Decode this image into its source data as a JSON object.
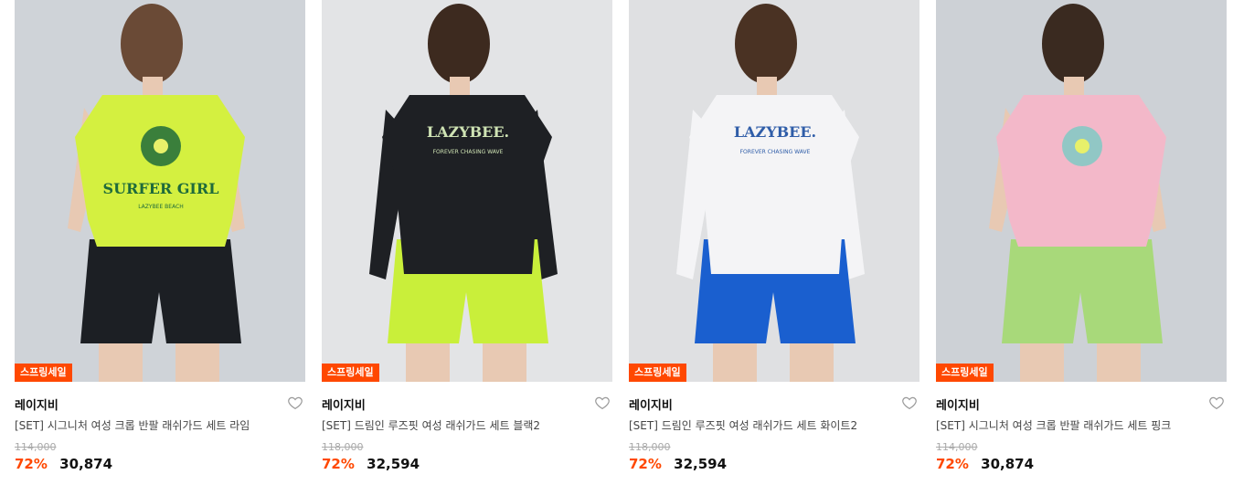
{
  "colors": {
    "accent": "#ff4800",
    "badge_bg": "#ff4800",
    "heart_stroke": "#999999"
  },
  "icons": {
    "wishlist": "heart-outline-icon"
  },
  "products": [
    {
      "badge": "스프링세일",
      "brand": "레이지비",
      "name": "[SET] 시그니처 여성 크롭 반팔 래쉬가드 세트 라임",
      "original_price": "114,000",
      "discount": "72%",
      "price": "30,874",
      "image": {
        "bg": "#cfd3d8",
        "top_color": "#d4f040",
        "bottom_color": "#1c1f24",
        "hair_color": "#6a4a36",
        "print_text": "SURFER GIRL",
        "print_subtext": "LAZYBEE BEACH",
        "print_color": "#1f6b3b",
        "long_sleeve": false
      }
    },
    {
      "badge": "스프링세일",
      "brand": "레이지비",
      "name": "[SET] 드림인 루즈핏 여성 래쉬가드 세트 블랙2",
      "original_price": "118,000",
      "discount": "72%",
      "price": "32,594",
      "image": {
        "bg": "#e3e4e6",
        "top_color": "#1e2024",
        "bottom_color": "#c9ef3a",
        "hair_color": "#3d2a1f",
        "print_text": "LAZYBEE.",
        "print_subtext": "FOREVER CHASING WAVE",
        "print_color": "#cfe3b4",
        "long_sleeve": true
      }
    },
    {
      "badge": "스프링세일",
      "brand": "레이지비",
      "name": "[SET] 드림인 루즈핏 여성 래쉬가드 세트 화이트2",
      "original_price": "118,000",
      "discount": "72%",
      "price": "32,594",
      "image": {
        "bg": "#dfe0e2",
        "top_color": "#f4f4f6",
        "bottom_color": "#1a5fcf",
        "hair_color": "#4a3223",
        "print_text": "LAZYBEE.",
        "print_subtext": "FOREVER CHASING WAVE",
        "print_color": "#2f5da8",
        "long_sleeve": true
      }
    },
    {
      "badge": "스프링세일",
      "brand": "레이지비",
      "name": "[SET] 시그니처 여성 크롭 반팔 래쉬가드 세트 핑크",
      "original_price": "114,000",
      "discount": "72%",
      "price": "30,874",
      "image": {
        "bg": "#cdd1d6",
        "top_color": "#f3b8c9",
        "bottom_color": "#a8d97a",
        "hair_color": "#3a2a20",
        "print_text": "",
        "print_subtext": "",
        "print_color": "#7fc9c4",
        "long_sleeve": false
      }
    }
  ]
}
